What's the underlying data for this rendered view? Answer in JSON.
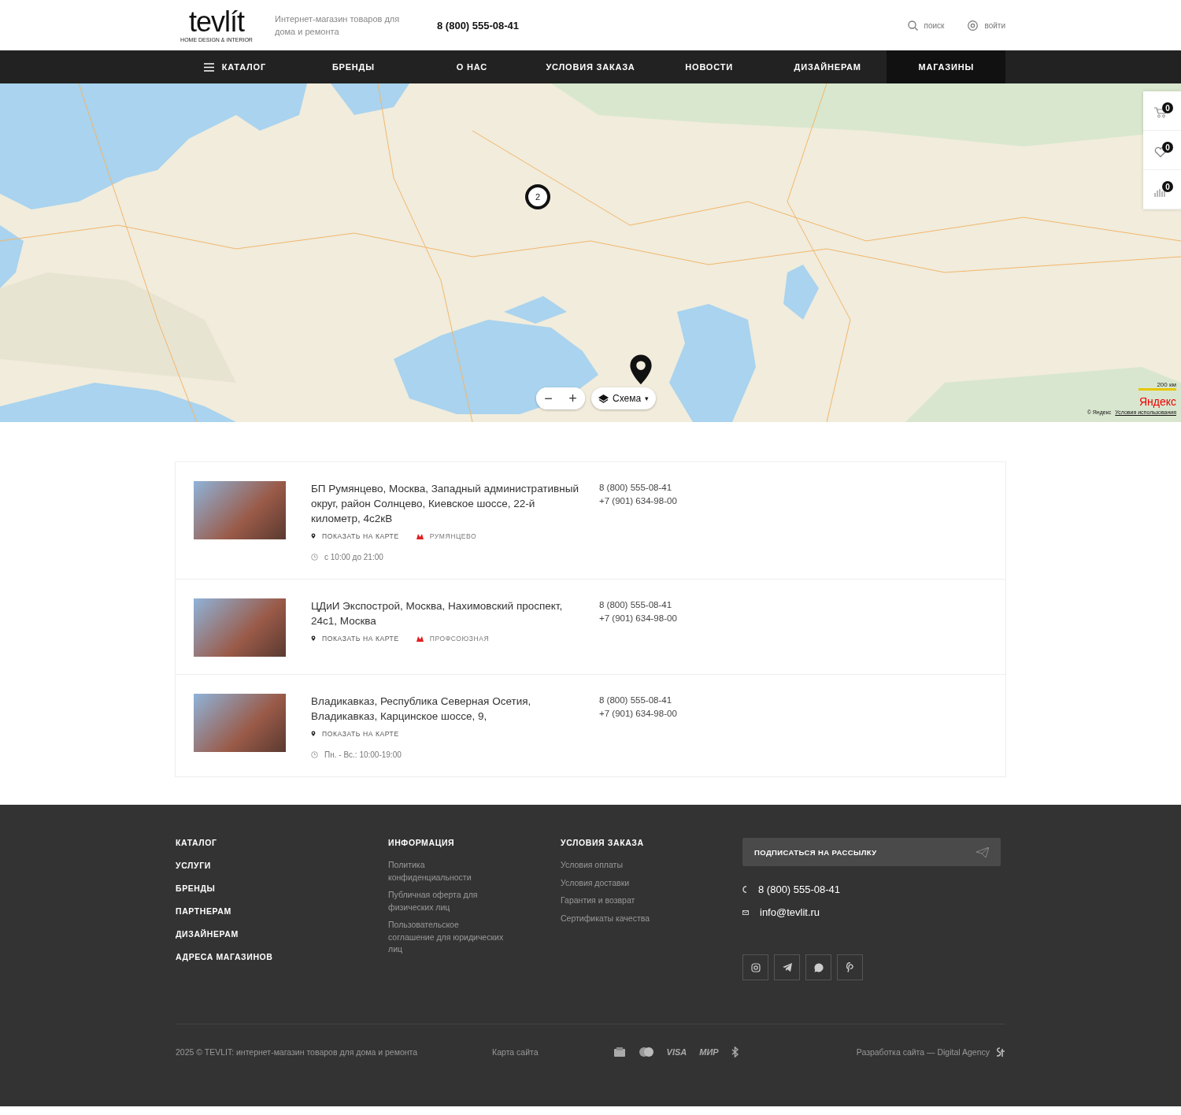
{
  "header": {
    "logo": "tevlít",
    "logo_tagline": "HOME DESIGN & INTERIOR",
    "slogan": "Интернет-магазин товаров для дома и ремонта",
    "phone": "8 (800) 555-08-41",
    "search": "поиск",
    "login": "войти"
  },
  "nav": [
    {
      "label": "КАТАЛОГ",
      "kind": "menu",
      "selected": false
    },
    {
      "label": "БРЕНДЫ",
      "kind": "link",
      "selected": false
    },
    {
      "label": "О НАС",
      "kind": "link",
      "selected": false
    },
    {
      "label": "УСЛОВИЯ ЗАКАЗА",
      "kind": "link",
      "selected": false
    },
    {
      "label": "НОВОСТИ",
      "kind": "link",
      "selected": false
    },
    {
      "label": "ДИЗАЙНЕРАМ",
      "kind": "link",
      "selected": false
    },
    {
      "label": "МАГАЗИНЫ",
      "kind": "link",
      "selected": true
    }
  ],
  "map": {
    "cluster": "2",
    "zoom_out": "−",
    "zoom_in": "+",
    "layers": "Схема",
    "caret": "▾",
    "scale": "200 км",
    "brand": "Яндекс",
    "copyright": "© Яндекс",
    "terms": "Условия использования"
  },
  "side_panel": [
    {
      "kind": "cart",
      "count": "0"
    },
    {
      "kind": "favorites",
      "count": "0"
    },
    {
      "kind": "compare",
      "count": "0"
    }
  ],
  "stores": [
    {
      "address": "БП Румянцево, Москва, Западный административный округ, район Солнцево, Киевское шоссе, 22-й километр, 4с2кВ",
      "phones": [
        "8 (800) 555-08-41",
        "+7 (901) 634-98-00"
      ],
      "map_link": "ПОКАЗАТЬ НА КАРТЕ",
      "metro": {
        "name": "РУМЯНЦЕВО",
        "color": "#e02020"
      },
      "hours": "с 10:00 до 21:00"
    },
    {
      "address": "ЦДиИ Экспострой, Москва, Нахимовский проспект, 24с1, Москва",
      "phones": [
        "8 (800) 555-08-41",
        "+7 (901) 634-98-00"
      ],
      "map_link": "ПОКАЗАТЬ НА КАРТЕ",
      "metro": {
        "name": "ПРОФСОЮЗНАЯ",
        "color": "#e02020"
      }
    },
    {
      "address": "Владикавказ, Республика Северная Осетия, Владикавказ, Карцинское шоссе, 9,",
      "phones": [
        "8 (800) 555-08-41",
        "+7 (901) 634-98-00"
      ],
      "map_link": "ПОКАЗАТЬ НА КАРТЕ",
      "hours": "Пн. - Вс.: 10:00-19:00"
    }
  ],
  "footer": {
    "main_links": [
      "КАТАЛОГ",
      "УСЛУГИ",
      "БРЕНДЫ",
      "ПАРТНЕРАМ",
      "ДИЗАЙНЕРАМ",
      "АДРЕСА МАГАЗИНОВ"
    ],
    "columns": [
      {
        "title": "ИНФОРМАЦИЯ",
        "links": [
          "Политика конфиденциальности",
          "Публичная оферта для физических лиц",
          "Пользовательское соглашение для юридических лиц"
        ]
      },
      {
        "title": "УСЛОВИЯ ЗАКАЗА",
        "links": [
          "Условия оплаты",
          "Условия доставки",
          "Гарантия и возврат",
          "Сертификаты качества"
        ]
      }
    ],
    "subscribe": "ПОДПИСАТЬСЯ НА РАССЫЛКУ",
    "phone": "8 (800) 555-08-41",
    "email": "info@tevlit.ru",
    "socials": [
      {
        "kind": "instagram"
      },
      {
        "kind": "telegram"
      },
      {
        "kind": "whatsapp"
      },
      {
        "kind": "pinterest"
      }
    ],
    "copyright": "2025 © TEVLIT: интернет-магазин товаров для дома и ремонта",
    "sitemap": "Карта сайта",
    "payments": [
      {
        "kind": "card"
      },
      {
        "kind": "mastercard"
      },
      {
        "kind": "text",
        "label": "VISA"
      },
      {
        "kind": "text",
        "label": "МИР"
      },
      {
        "kind": "bluetooth"
      }
    ],
    "developer": "Разработка сайта — Digital Agency"
  }
}
